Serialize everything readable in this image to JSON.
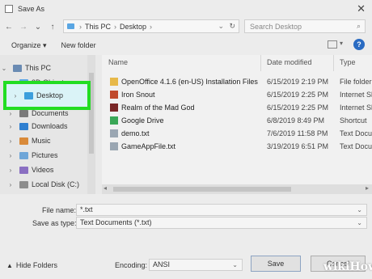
{
  "window": {
    "title": "Save As",
    "close_glyph": "✕"
  },
  "nav": {
    "back": "←",
    "forward": "→",
    "dropdown": "⌄",
    "up": "↑",
    "breadcrumb": [
      "This PC",
      "Desktop"
    ],
    "search_placeholder": "Search Desktop"
  },
  "toolbar": {
    "organize": "Organize ▾",
    "new_folder": "New folder",
    "help": "?"
  },
  "sidebar": {
    "items": [
      {
        "label": "This PC",
        "icon": "computer-icon",
        "color": "#6a8bb3"
      },
      {
        "label": "3D Objects",
        "icon": "3d-objects-icon",
        "color": "#5aa6e3"
      },
      {
        "label": "Desktop",
        "icon": "desktop-folder-icon",
        "color": "#3c9fdc"
      },
      {
        "label": "Documents",
        "icon": "documents-folder-icon",
        "color": "#7a7a7a"
      },
      {
        "label": "Downloads",
        "icon": "downloads-folder-icon",
        "color": "#2f7fd0"
      },
      {
        "label": "Music",
        "icon": "music-folder-icon",
        "color": "#d98a3a"
      },
      {
        "label": "Pictures",
        "icon": "pictures-folder-icon",
        "color": "#6fa6d8"
      },
      {
        "label": "Videos",
        "icon": "videos-folder-icon",
        "color": "#8a6fc2"
      },
      {
        "label": "Local Disk (C:)",
        "icon": "drive-icon",
        "color": "#8d8d8d"
      }
    ]
  },
  "columns": {
    "name": "Name",
    "date": "Date modified",
    "type": "Type"
  },
  "files": [
    {
      "name": "OpenOffice 4.1.6 (en-US) Installation Files",
      "date": "6/15/2019 2:19 PM",
      "type": "File folder",
      "icon": "folder-icon",
      "color": "#e7b94a"
    },
    {
      "name": "Iron Snout",
      "date": "6/15/2019 2:25 PM",
      "type": "Internet Sh",
      "icon": "game-shortcut-icon",
      "color": "#c04a2d"
    },
    {
      "name": "Realm of the Mad God",
      "date": "6/15/2019 2:25 PM",
      "type": "Internet Sh",
      "icon": "game-shortcut-icon",
      "color": "#7a2727"
    },
    {
      "name": "Google Drive",
      "date": "6/8/2019 8:49 PM",
      "type": "Shortcut",
      "icon": "google-drive-icon",
      "color": "#3aa757"
    },
    {
      "name": "demo.txt",
      "date": "7/6/2019 11:58 PM",
      "type": "Text Docum",
      "icon": "text-file-icon",
      "color": "#9aa6b2"
    },
    {
      "name": "GameAppFile.txt",
      "date": "3/19/2019 6:51 PM",
      "type": "Text Docum",
      "icon": "text-file-icon",
      "color": "#9aa6b2"
    }
  ],
  "form": {
    "file_name_label": "File name:",
    "file_name_value": "*.txt",
    "save_type_label": "Save as type:",
    "save_type_value": "Text Documents (*.txt)",
    "encoding_label": "Encoding:",
    "encoding_value": "ANSI",
    "hide_folders": "Hide Folders",
    "save": "Save",
    "cancel": "Cancel"
  },
  "watermark": "wikiHow",
  "colors": {
    "highlight_box": "#22dd22"
  }
}
